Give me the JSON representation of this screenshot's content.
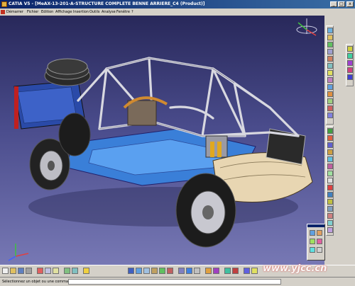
{
  "window": {
    "title": "CATIA V5 - [MeAX-13-201-A-STRUCTURE COMPLETE BENNE ARRIERE_C4 (Product)]",
    "minimize": "_",
    "maximize": "□",
    "close": "x"
  },
  "menu": {
    "items": [
      "Démarrer",
      "Fichier",
      "Edition",
      "Affichage",
      "Insertion",
      "Outils",
      "Analyse",
      "Fenêtre",
      "?"
    ]
  },
  "status": {
    "prompt": "Sélectionnez un objet ou une commande"
  },
  "watermark": "www.yjcc.cn",
  "colors": {
    "viewport_top": "#28285a",
    "viewport_bottom": "#7778b4",
    "titlebar": "#0a246a",
    "panel": "#d4d0c8"
  }
}
